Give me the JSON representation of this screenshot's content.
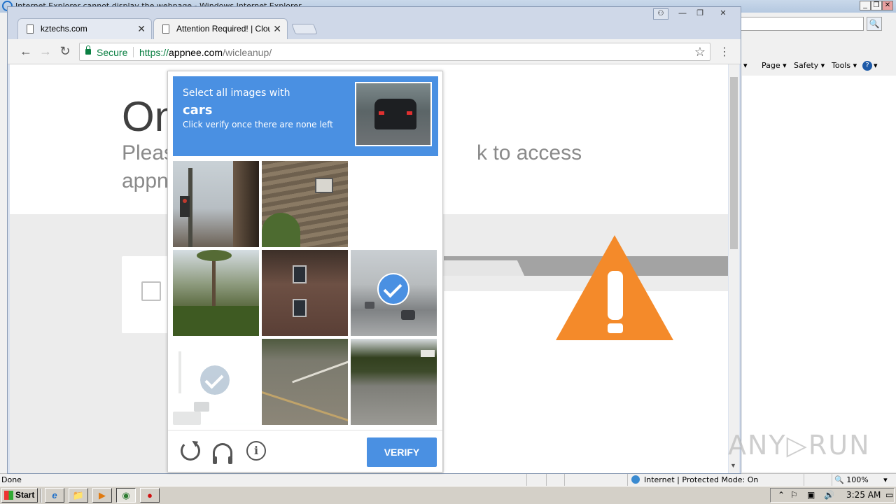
{
  "ie": {
    "title": "Internet Explorer cannot display the webpage - Windows Internet Explorer",
    "title_buttons": [
      "_",
      "❐",
      "✕"
    ],
    "command_bar": [
      "Page ▾",
      "Safety ▾",
      "Tools ▾",
      "▾"
    ],
    "help_icon": "?",
    "search_icon": "🔍",
    "status": {
      "left": "Done",
      "zone": "Internet | Protected Mode: On",
      "zoom": "100%",
      "zoom_icon": "🔍",
      "zoom_arrow": "▾"
    }
  },
  "chrome": {
    "tabs": [
      {
        "title": "kztechs.com",
        "close": "✕"
      },
      {
        "title": "Attention Required! | Cloudf",
        "close": "✕"
      }
    ],
    "window_buttons": [
      "⚇",
      "—",
      "❐",
      "✕"
    ],
    "toolbar": {
      "back": "←",
      "forward": "→",
      "reload": "↻",
      "secure_label": "Secure",
      "url_scheme": "https://",
      "url_host": "appnee.com",
      "url_path": "/wicleanup/",
      "star": "☆",
      "menu": "⋮"
    }
  },
  "page": {
    "heading": "On",
    "subtitle_line1": "Pleas",
    "subtitle_line1_end": "k to access",
    "subtitle_line2": "appn"
  },
  "recaptcha": {
    "instruction_line1": "Select all images with",
    "target": "cars",
    "instruction_line3": "Click verify once there are none left",
    "verify_label": "VERIFY",
    "info_glyph": "i",
    "tiles": [
      {
        "selected": false,
        "faded": false,
        "scene": "traffic-light-corner"
      },
      {
        "selected": false,
        "faded": false,
        "scene": "brick-wall-lamp"
      },
      {
        "selected": false,
        "faded": true,
        "scene": "blank-fading"
      },
      {
        "selected": false,
        "faded": false,
        "scene": "palm-trees-street"
      },
      {
        "selected": false,
        "faded": false,
        "scene": "brick-house"
      },
      {
        "selected": true,
        "faded": false,
        "scene": "highway-cars"
      },
      {
        "selected": true,
        "faded": true,
        "scene": "intersection-cars"
      },
      {
        "selected": false,
        "faded": false,
        "scene": "road-crosswalk"
      },
      {
        "selected": false,
        "faded": false,
        "scene": "road-trees"
      }
    ]
  },
  "watermark": "ANY▷RUN",
  "taskbar": {
    "start_label": "Start",
    "buttons": [
      "e",
      "📁",
      "▶",
      "◉",
      "●"
    ],
    "tray_icons": [
      "⌃",
      "⚐",
      "▣",
      "🔊",
      "▭"
    ],
    "clock": "3:25 AM"
  },
  "colors": {
    "recaptcha_blue": "#4a90e2",
    "secure_green": "#0b8043",
    "warning_orange": "#f48a2a"
  }
}
